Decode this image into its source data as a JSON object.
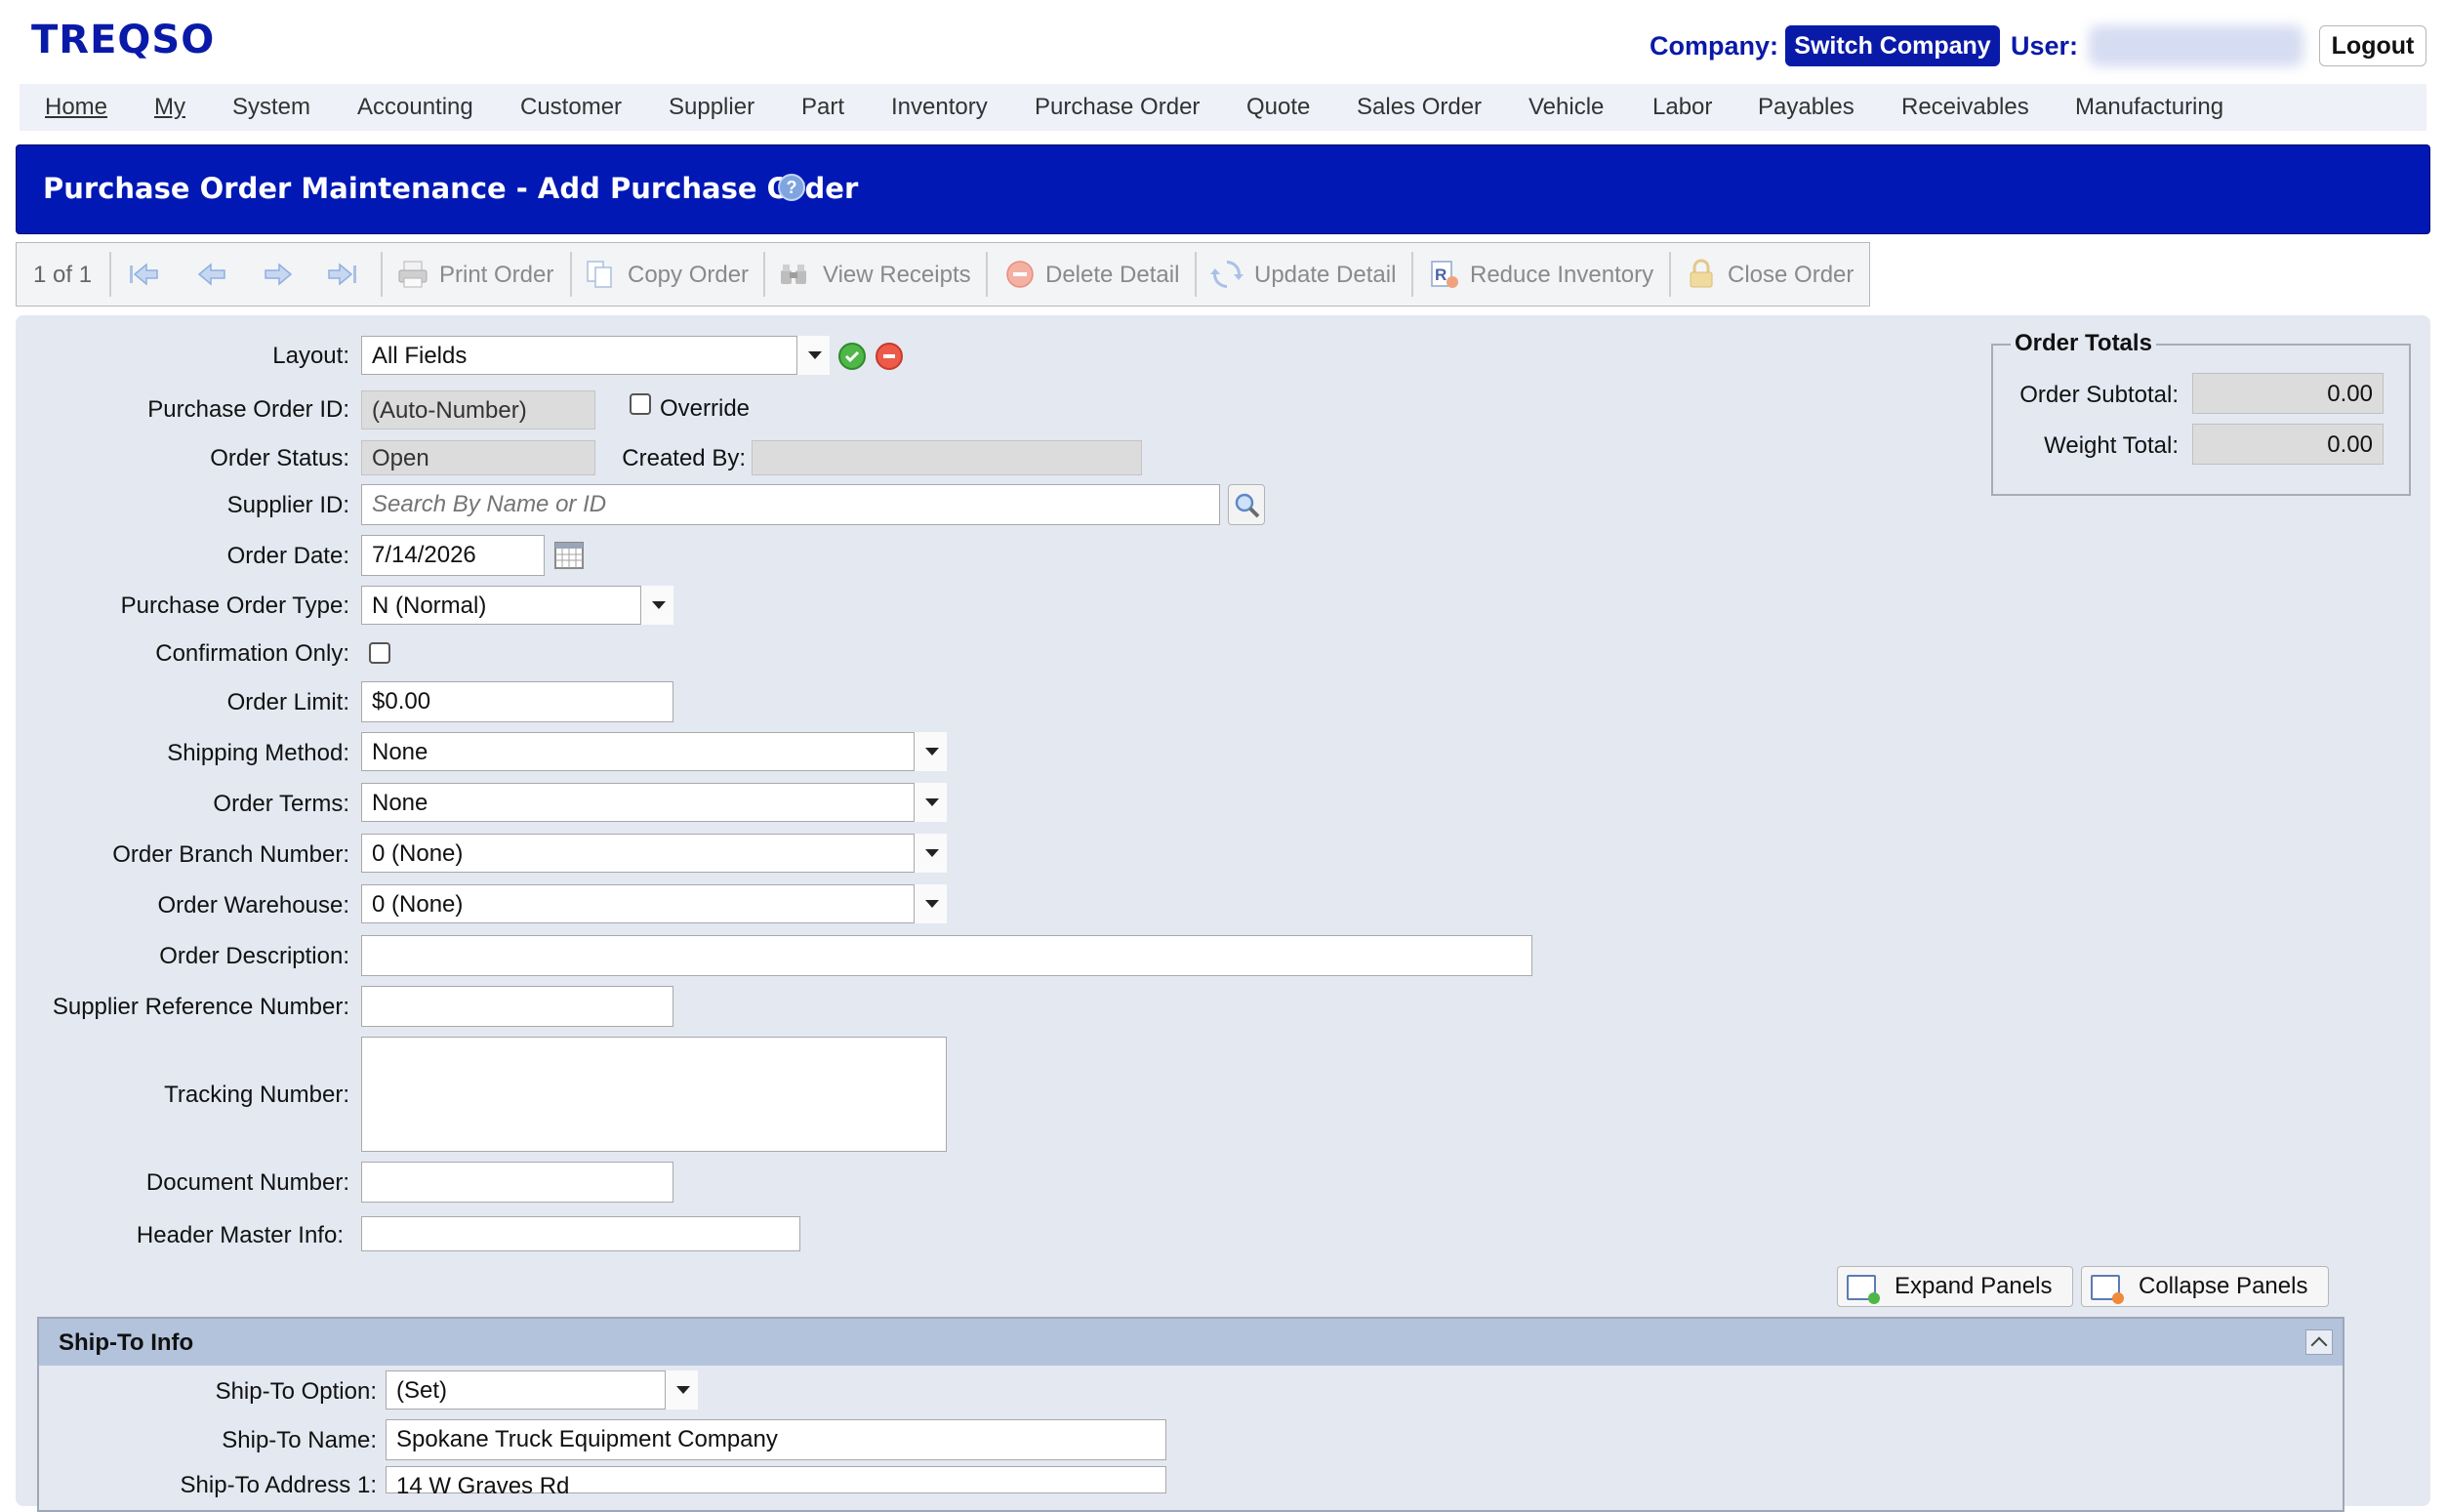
{
  "header": {
    "logo": "TREQSO",
    "company_label": "Company:",
    "switch_company": "Switch Company",
    "user_label": "User:",
    "logout": "Logout"
  },
  "menu": [
    "Home",
    "My",
    "System",
    "Accounting",
    "Customer",
    "Supplier",
    "Part",
    "Inventory",
    "Purchase Order",
    "Quote",
    "Sales Order",
    "Vehicle",
    "Labor",
    "Payables",
    "Receivables",
    "Manufacturing"
  ],
  "page_title": "Purchase Order Maintenance - Add Purchase Order",
  "toolbar": {
    "record_count": "1 of 1",
    "print_order": "Print Order",
    "copy_order": "Copy Order",
    "view_receipts": "View Receipts",
    "delete_detail": "Delete Detail",
    "update_detail": "Update Detail",
    "reduce_inventory": "Reduce Inventory",
    "close_order": "Close Order"
  },
  "form": {
    "layout": {
      "label": "Layout:",
      "value": "All Fields"
    },
    "po_id": {
      "label": "Purchase Order ID:",
      "value": "(Auto-Number)",
      "override_label": "Override"
    },
    "status": {
      "label": "Order Status:",
      "value": "Open",
      "created_by_label": "Created By:",
      "created_by_value": ""
    },
    "supplier": {
      "label": "Supplier ID:",
      "placeholder": "Search By Name or ID"
    },
    "order_date": {
      "label": "Order Date:",
      "value": "7/14/2026"
    },
    "po_type": {
      "label": "Purchase Order Type:",
      "value": "N (Normal)"
    },
    "confirmation": {
      "label": "Confirmation Only:"
    },
    "order_limit": {
      "label": "Order Limit:",
      "value": "$0.00"
    },
    "shipping_method": {
      "label": "Shipping Method:",
      "value": "None"
    },
    "order_terms": {
      "label": "Order Terms:",
      "value": "None"
    },
    "branch": {
      "label": "Order Branch Number:",
      "value": "0 (None)"
    },
    "warehouse": {
      "label": "Order Warehouse:",
      "value": "0 (None)"
    },
    "description": {
      "label": "Order Description:",
      "value": ""
    },
    "supplier_ref": {
      "label": "Supplier Reference Number:",
      "value": ""
    },
    "tracking": {
      "label": "Tracking Number:",
      "value": ""
    },
    "document": {
      "label": "Document Number:",
      "value": ""
    },
    "header_master": {
      "label": "Header Master Info:",
      "value": ""
    }
  },
  "totals": {
    "legend": "Order Totals",
    "subtotal_label": "Order Subtotal:",
    "subtotal_value": "0.00",
    "weight_label": "Weight Total:",
    "weight_value": "0.00"
  },
  "panel_buttons": {
    "expand": "Expand Panels",
    "collapse": "Collapse Panels"
  },
  "ship_to": {
    "title": "Ship-To Info",
    "option_label": "Ship-To Option:",
    "option_value": "(Set)",
    "name_label": "Ship-To Name:",
    "name_value": "Spokane Truck Equipment Company",
    "address1_label": "Ship-To Address 1:",
    "address1_value": "14 W Graves Rd"
  },
  "colors": {
    "brand": "#0a1aa8",
    "title_bar": "#0118b5",
    "panel_bg": "#e3e8f1"
  }
}
